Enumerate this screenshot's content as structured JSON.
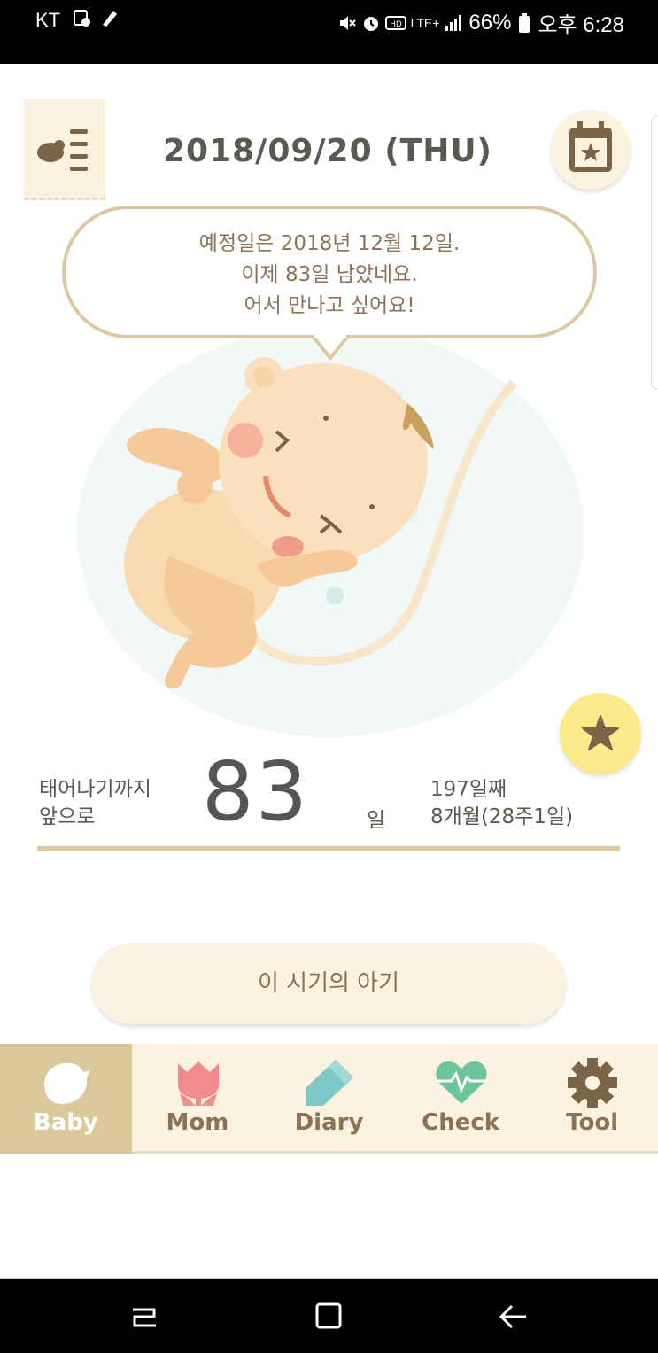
{
  "status_bar": {
    "carrier": "KT",
    "battery": "66%",
    "time": "오후 6:28",
    "network": "LTE+"
  },
  "header": {
    "date": "2018/09/20 (THU)",
    "menu_icon": "baby-list-icon",
    "calendar_icon": "calendar-star-icon"
  },
  "bubble": {
    "lines": [
      "예정일은 2018년 12월 12일.",
      "이제 83일 남았네요.",
      "어서 만나고 싶어요!"
    ]
  },
  "countdown": {
    "prefix_line1": "태어나기까지",
    "prefix_line2": "앞으로",
    "days": "83",
    "unit": "일",
    "day_count": "197일째",
    "month_week": "8개월(28주1일)"
  },
  "period_button": {
    "label": "이 시기의 아기"
  },
  "tabs": [
    {
      "label": "Baby",
      "icon": "bird-icon",
      "active": true
    },
    {
      "label": "Mom",
      "icon": "tulip-icon",
      "active": false
    },
    {
      "label": "Diary",
      "icon": "pen-icon",
      "active": false
    },
    {
      "label": "Check",
      "icon": "heartbeat-icon",
      "active": false
    },
    {
      "label": "Tool",
      "icon": "gear-icon",
      "active": false
    }
  ],
  "colors": {
    "accent_beige": "#dcc79a",
    "panel_cream": "#fbf3df",
    "text_brown": "#8c7257",
    "star_yellow": "#fbe98a"
  }
}
